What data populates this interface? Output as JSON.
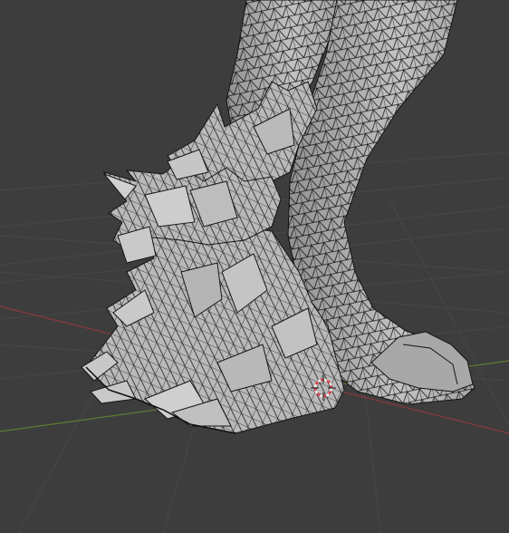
{
  "viewport": {
    "background": "#3d3d3d",
    "grid_color": "#474747",
    "axis_x_color": "#8a3a3f",
    "axis_y_color": "#5d7c2f"
  },
  "mesh": {
    "fill": "#bdbdbd",
    "fill_shade": "#9c9c9c",
    "wire": "#141414"
  },
  "cursor": {
    "icon": "3d-cursor-icon",
    "ring_red": "#d9434b",
    "ring_white": "#f2f2f2"
  }
}
